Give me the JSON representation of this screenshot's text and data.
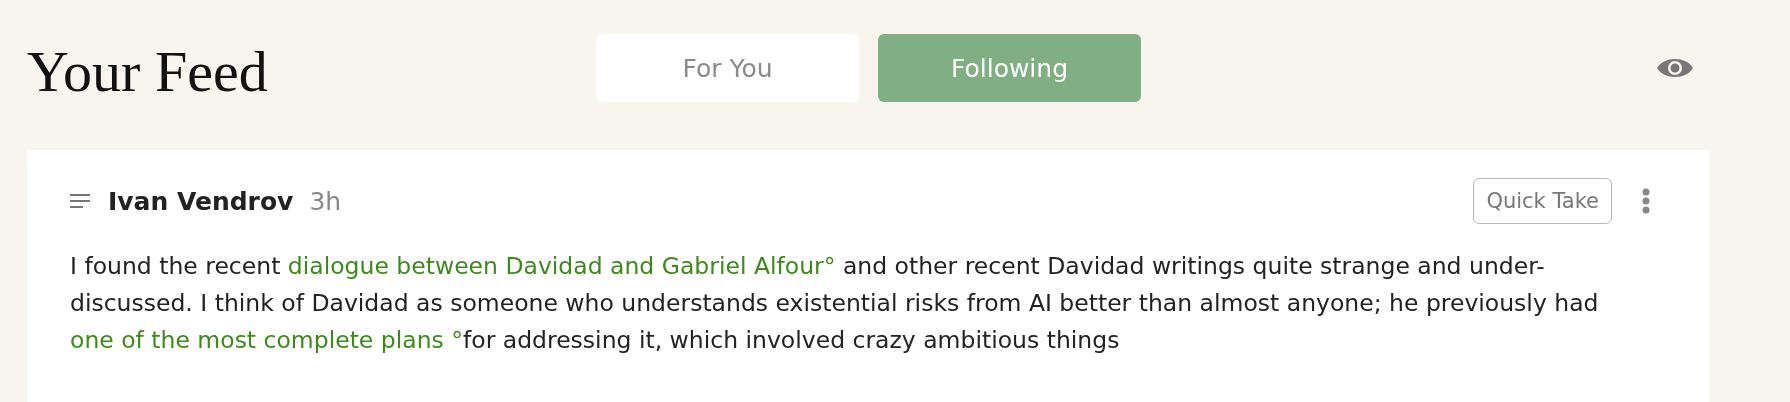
{
  "header": {
    "title": "Your Feed",
    "tabs": [
      {
        "label": "For You",
        "selected": false
      },
      {
        "label": "Following",
        "selected": true
      }
    ]
  },
  "post": {
    "author": "Ivan Vendrov",
    "age": "3h",
    "tag_button": "Quick Take",
    "body": [
      {
        "kind": "text",
        "text": "I found the recent "
      },
      {
        "kind": "link",
        "text": "dialogue between Davidad and Gabriel Alfour°"
      },
      {
        "kind": "text",
        "text": " and other recent Davidad writings quite strange and under-discussed. I think of Davidad as someone who understands existential risks from AI better than almost anyone; he previously had "
      },
      {
        "kind": "link",
        "text": "one of the most complete plans °"
      },
      {
        "kind": "text",
        "text": "for addressing it, which involved crazy ambitious things"
      }
    ]
  }
}
